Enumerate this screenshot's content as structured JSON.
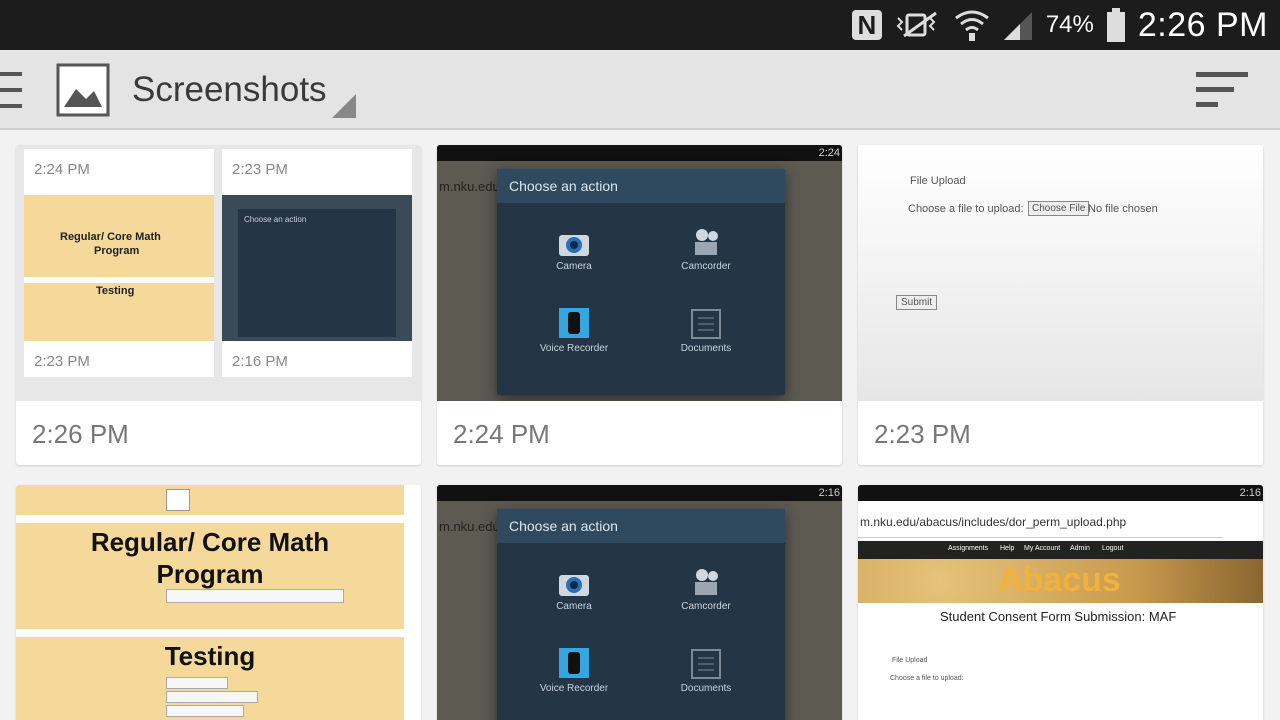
{
  "status_bar": {
    "nfc_label": "N",
    "battery_percent": "74%",
    "time": "2:26 PM",
    "icons": [
      "nfc-icon",
      "vibrate-icon",
      "wifi-icon",
      "signal-icon",
      "battery-icon"
    ]
  },
  "app_bar": {
    "title": "Screenshots",
    "icons": [
      "menu-icon",
      "album-icon",
      "dropdown-icon",
      "sort-icon"
    ]
  },
  "cards": [
    {
      "label": "2:26 PM",
      "mini_times": [
        "2:24 PM",
        "2:23 PM",
        "2:23 PM",
        "2:16 PM"
      ],
      "doc_heading": "Regular/ Core Math",
      "doc_heading2": "Program",
      "doc_section": "Testing",
      "dialog_title": "Choose an action"
    },
    {
      "label": "2:24 PM",
      "url": "m.nku.edu",
      "status": "2:24",
      "dialog_title": "Choose an action",
      "actions": [
        "Camera",
        "Camcorder",
        "Voice Recorder",
        "Documents"
      ]
    },
    {
      "label": "2:23 PM",
      "upload_title": "File Upload",
      "upload_prompt": "Choose a file to upload:",
      "choose_button": "Choose File",
      "no_file": "No file chosen",
      "submit_button": "Submit"
    },
    {
      "doc_heading": "Regular/ Core Math",
      "doc_heading2": "Program",
      "doc_section": "Testing"
    },
    {
      "url": "m.nku.edu",
      "status": "2:16",
      "dialog_title": "Choose an action",
      "actions": [
        "Camera",
        "Camcorder",
        "Voice Recorder",
        "Documents"
      ]
    },
    {
      "url": "m.nku.edu/abacus/includes/dor_perm_upload.php",
      "status": "2:16",
      "nav": [
        "Assignments",
        "Help",
        "My Account",
        "Admin",
        "Logout"
      ],
      "brand": "Abacus",
      "heading": "Student Consent Form Submission: MAF",
      "upload_title": "File Upload",
      "upload_prompt": "Choose a file to upload:"
    }
  ],
  "colors": {
    "status_bar_bg": "#1c1c1c",
    "app_bar_bg": "#e4e4e4",
    "dialog_bg": "#243646",
    "dialog_header_bg": "#2f4a5e",
    "document_bg": "#f4d99a"
  }
}
